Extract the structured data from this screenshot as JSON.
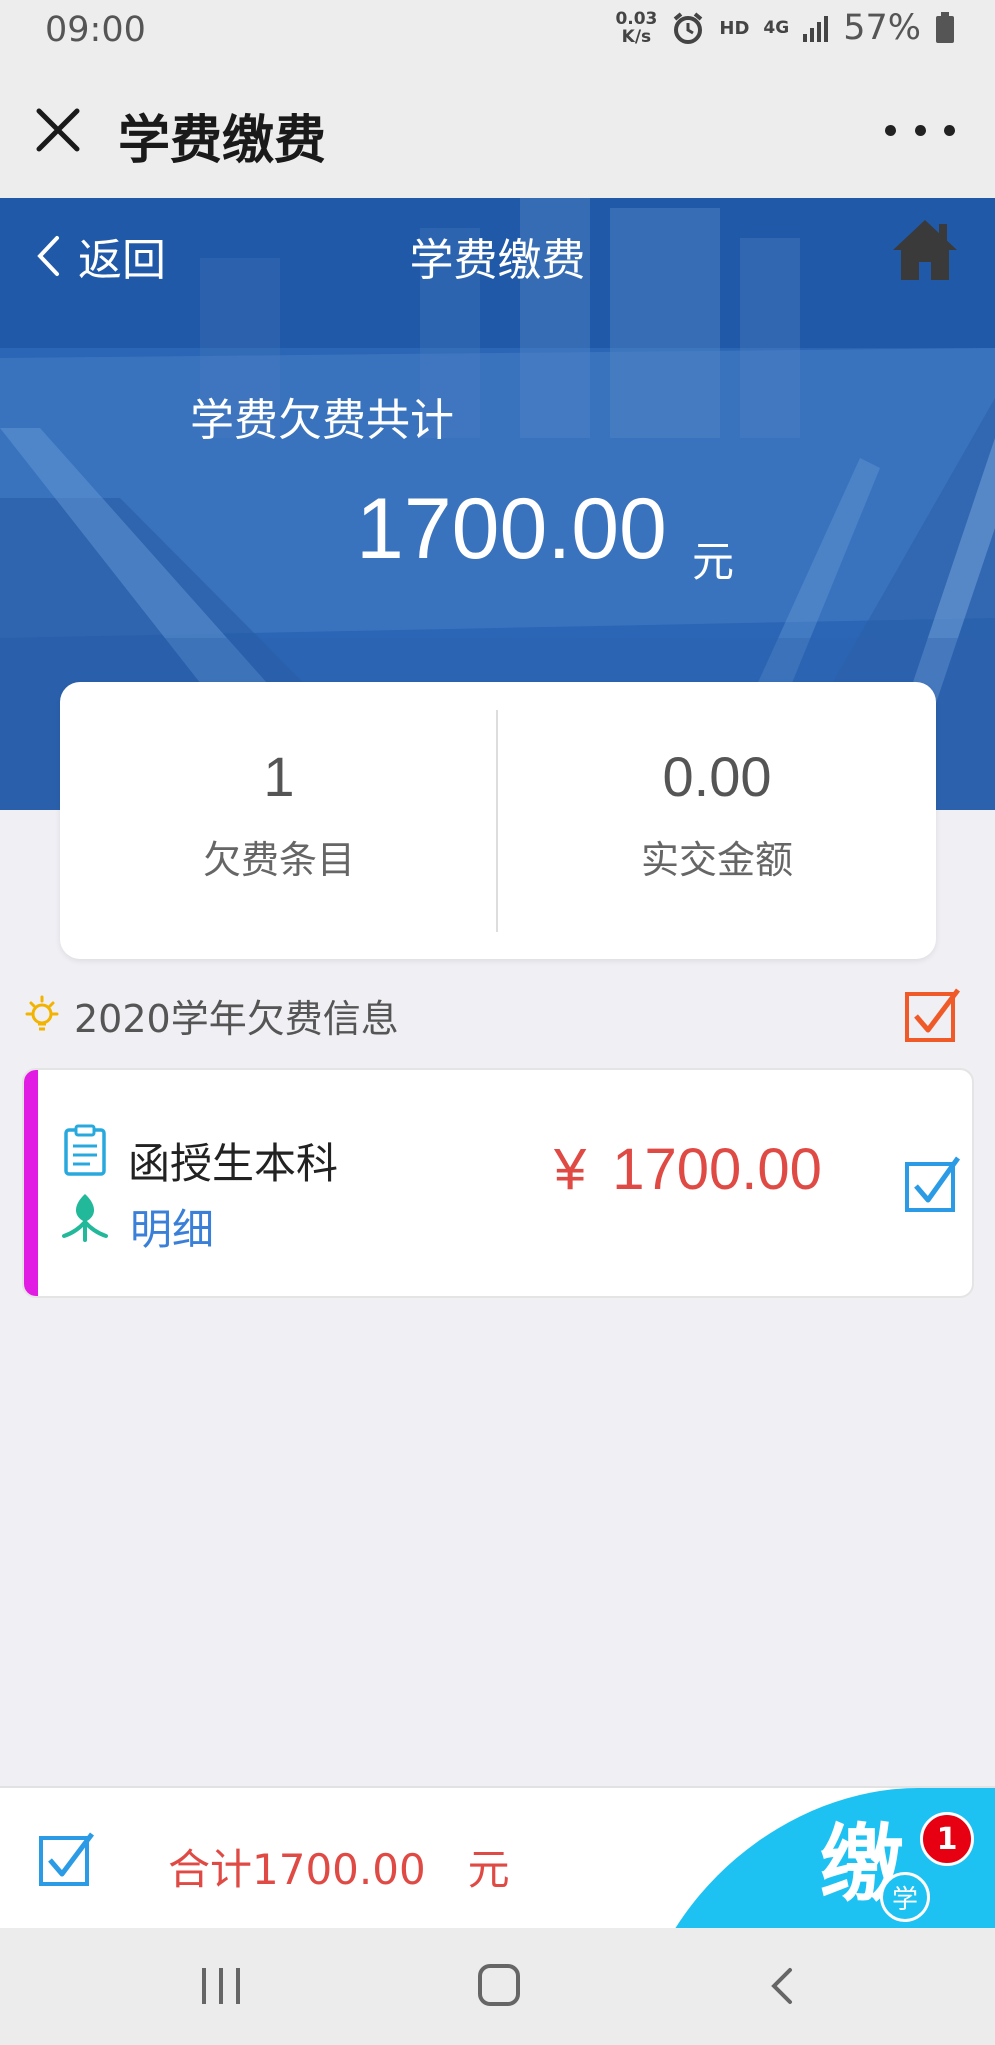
{
  "status_bar": {
    "time": "09:00",
    "net_speed_value": "0.03",
    "net_speed_unit": "K/s",
    "hd": "HD",
    "network": "4G",
    "battery": "57%"
  },
  "wechat_bar": {
    "title": "学费缴费"
  },
  "header": {
    "back_label": "返回",
    "title": "学费缴费"
  },
  "hero": {
    "owed_label": "学费欠费共计",
    "owed_amount": "1700.00",
    "owed_unit": "元"
  },
  "summary": {
    "items_count": "1",
    "items_label": "欠费条目",
    "paid_amount": "0.00",
    "paid_label": "实交金额"
  },
  "section": {
    "title": "2020学年欠费信息",
    "checked": true
  },
  "fee_items": [
    {
      "name": "函授生本科",
      "detail_label": "明细",
      "currency": "¥",
      "amount": "1700.00",
      "checked": true,
      "accent_color": "#e21de3"
    }
  ],
  "footer": {
    "total_text": "合计1700.00　元",
    "pay_mark": "缴",
    "pay_sub": "学",
    "badge_count": "1",
    "checked": true
  },
  "colors": {
    "accent_blue": "#2a6bbd",
    "price_red": "#e04a45",
    "check_orange": "#f05a28",
    "check_blue": "#2b9be6",
    "pay_cyan": "#1ec2f2"
  },
  "icons": [
    "close-icon",
    "more-icon",
    "back-chevron-icon",
    "home-icon",
    "lightbulb-icon",
    "checkbox-checked-icon",
    "clipboard-icon",
    "detail-leaf-icon"
  ]
}
